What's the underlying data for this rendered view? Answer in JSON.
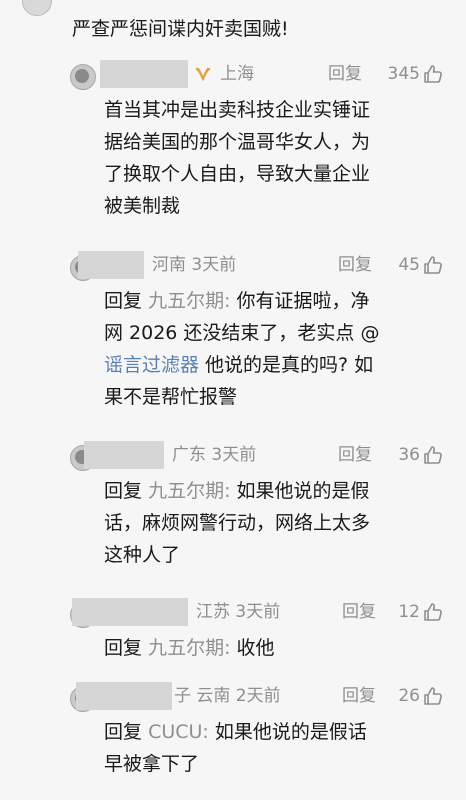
{
  "top_comment": {
    "text": "严查严惩间谍内奸卖国贼!"
  },
  "replies": [
    {
      "location": "上海",
      "reply_label": "回复",
      "likes": "345",
      "lines": [
        "首当其冲是出卖科技企业实锤证",
        "据给美国的那个温哥华女人，为",
        "了换取个人自由，导致大量企业",
        "被美制裁"
      ]
    },
    {
      "location": "河南 3天前",
      "reply_label": "回复",
      "likes": "45",
      "prefix": "回复",
      "mention": "九五尔期:",
      "line1_rest": " 你有证据啦，净",
      "line2": "网 2026 还没结束了，老实点 @",
      "link": "谣言过滤器",
      "line3_rest": " 他说的是真的吗? 如",
      "line4": "果不是帮忙报警"
    },
    {
      "location": "广东 3天前",
      "reply_label": "回复",
      "likes": "36",
      "prefix": "回复",
      "mention": "九五尔期:",
      "line1_rest": " 如果他说的是假",
      "line2": "话，麻烦网警行动，网络上太多",
      "line3": "这种人了"
    },
    {
      "location": "江苏 3天前",
      "reply_label": "回复",
      "likes": "12",
      "prefix": "回复",
      "mention": "九五尔期:",
      "line1_rest": " 收他"
    },
    {
      "location": "子 云南 2天前",
      "reply_label": "回复",
      "likes": "26",
      "prefix": "回复",
      "mention": "CUCU:",
      "line1_rest": " 如果他说的是假话",
      "line2": "早被拿下了"
    }
  ]
}
